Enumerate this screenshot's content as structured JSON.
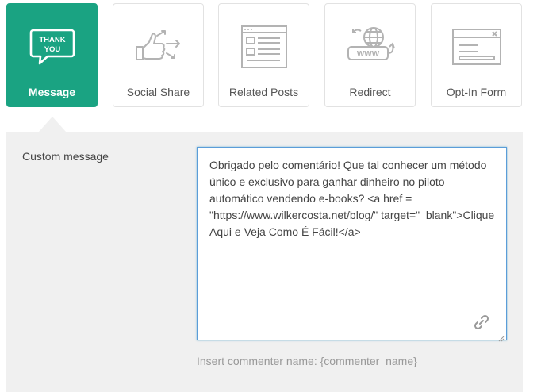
{
  "tabs": [
    {
      "label": "Message",
      "icon": "thank-you-bubble-icon",
      "active": true,
      "icon_text_line1": "THANK",
      "icon_text_line2": "YOU"
    },
    {
      "label": "Social Share",
      "icon": "thumbs-up-share-icon",
      "active": false
    },
    {
      "label": "Related Posts",
      "icon": "document-list-icon",
      "active": false
    },
    {
      "label": "Redirect",
      "icon": "globe-www-icon",
      "active": false,
      "icon_text": "WWW"
    },
    {
      "label": "Opt-In Form",
      "icon": "optin-window-icon",
      "active": false
    }
  ],
  "custom_message": {
    "label": "Custom message",
    "value": "Obrigado pelo comentário! Que tal conhecer um método único e exclusivo para ganhar dinheiro no piloto automático vendendo e-books? <a href = \"https://www.wilkercosta.net/blog/\" target=\"_blank\">Clique Aqui e Veja Como É Fácil!</a>",
    "hint": "Insert commenter name: {commenter_name}"
  },
  "colors": {
    "accent": "#1aa382",
    "panel_bg": "#f0f0f0",
    "focus_border": "#5b9dd9",
    "icon_gray": "#b3b3b3"
  }
}
